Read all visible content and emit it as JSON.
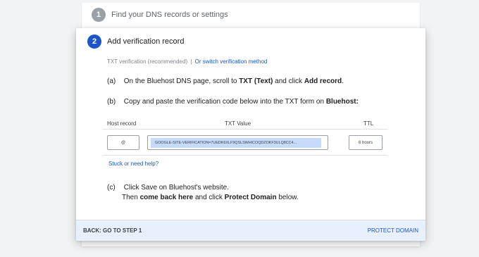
{
  "step1": {
    "number": "1",
    "title": "Find your DNS records or settings"
  },
  "step2": {
    "number": "2",
    "title": "Add verification record"
  },
  "method": {
    "recommended": "TXT verification (recommended)",
    "separator": "|",
    "switch_link": "Or switch verification method"
  },
  "instructions": {
    "a": {
      "label": "(a)",
      "text1": "On the Bluehost DNS page, scroll to",
      "bold1": "TXT (Text)",
      "text2": "and click",
      "bold2": "Add record",
      "text3": "."
    },
    "b": {
      "label": "(b)",
      "text1": "Copy and paste the verification code below into the TXT form on",
      "bold1": "Bluehost:"
    },
    "c": {
      "label": "(c)",
      "line1": "Click Save on Bluehost's website.",
      "line2_text1": "Then",
      "line2_bold1": "come back here",
      "line2_text2": "and click",
      "line2_bold2": "Protect Domain",
      "line2_text3": "below."
    }
  },
  "table": {
    "headers": {
      "host": "Host record",
      "txt": "TXT Value",
      "ttl": "TTL"
    },
    "host_value": "@",
    "txt_value": "GOOGLE-SITE-VERIFICATION=7UEDK6XLF9QSLSWHICOQDZOKF3ULQ8CC4...",
    "ttl_value": "6 hours"
  },
  "help_link": "Stuck or need help?",
  "footer": {
    "back": "BACK: GO TO STEP 1",
    "protect": "PROTECT DOMAIN"
  },
  "colors": {
    "accent": "#1a56c7",
    "footer_bg": "#e8f0fe",
    "selection": "#c6dafc"
  }
}
